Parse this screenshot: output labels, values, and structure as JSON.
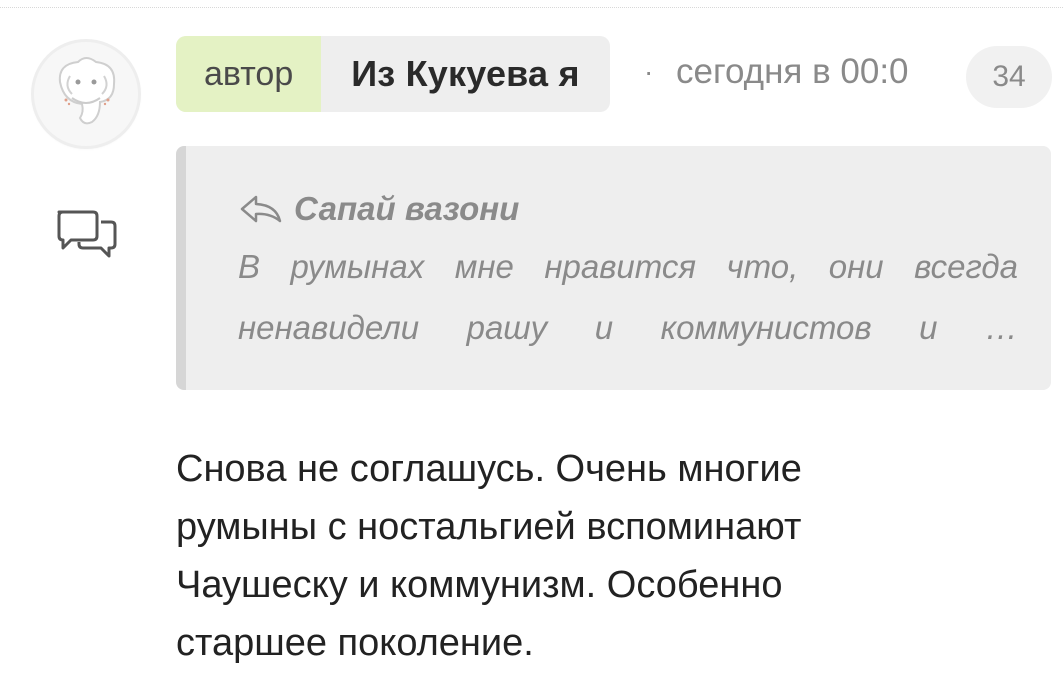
{
  "header": {
    "author_tag": "автор",
    "author_name": "Из Кукуева я",
    "separator": "·",
    "timestamp": "сегодня в 00:0",
    "count": "34"
  },
  "quote": {
    "author": "Сапай вазони",
    "lines": [
      "В румынах мне нравится что, они всегда",
      "ненавидели рашу и коммунистов и …"
    ]
  },
  "message": {
    "lines": [
      "Снова не соглашусь. Очень многие",
      "румыны с ностальгией вспоминают",
      "Чаушеску и коммунизм. Особенно",
      "старшее поколение."
    ]
  },
  "icons": {
    "avatar": "elephant-avatar",
    "reply": "speech-bubbles-icon",
    "quote_arrow": "reply-arrow-icon"
  },
  "colors": {
    "author_tag_bg": "#e4f2c4",
    "pill_bg": "#eeeeee",
    "muted_text": "#8a8a8a",
    "quote_bg": "#eeeeee",
    "quote_border": "#d6d6d6"
  }
}
